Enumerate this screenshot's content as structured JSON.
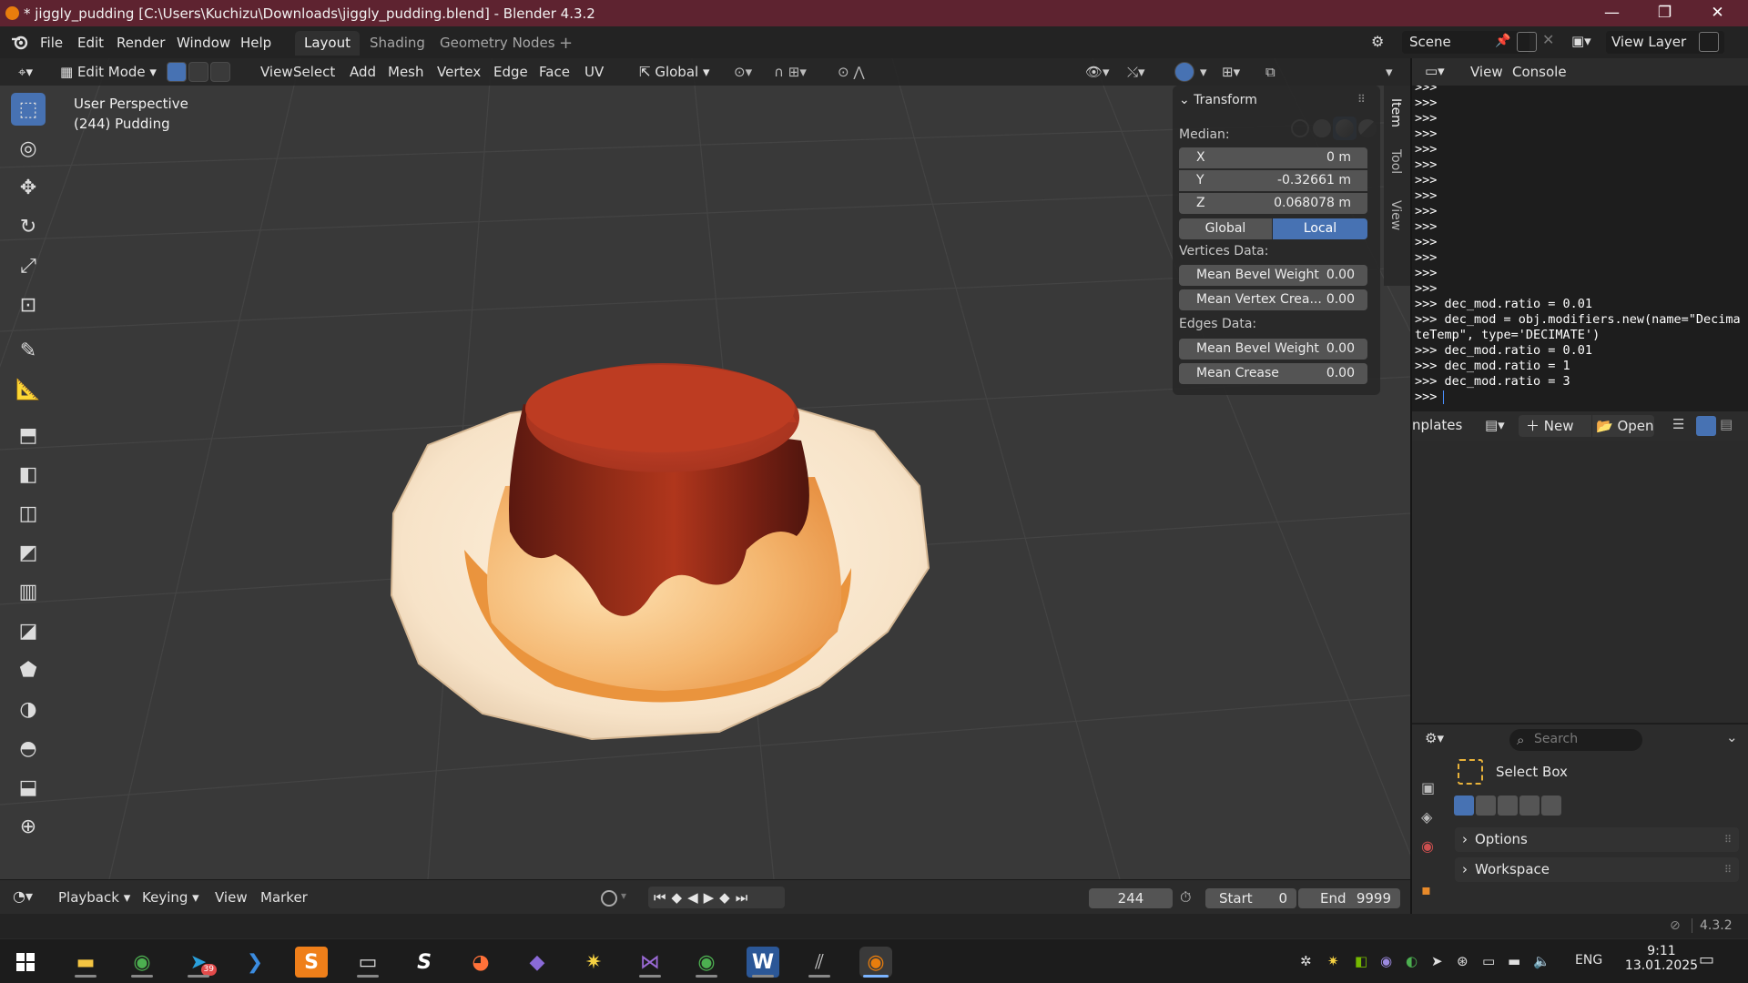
{
  "window": {
    "title": "* jiggly_pudding [C:\\Users\\Kuchizu\\Downloads\\jiggly_pudding.blend] - Blender 4.3.2",
    "controls": [
      "—",
      "❐",
      "✕"
    ]
  },
  "topbar": {
    "menus": [
      "File",
      "Edit",
      "Render",
      "Window",
      "Help"
    ],
    "workspaces": [
      "Layout",
      "Shading",
      "Geometry Nodes"
    ],
    "active_workspace": "Layout",
    "add_workspace": "+",
    "scene_label": "Scene",
    "view_layer_label": "View Layer"
  },
  "viewport_header": {
    "mode": "Edit Mode",
    "menus": [
      "View",
      "Select",
      "Add",
      "Mesh",
      "Vertex",
      "Edge",
      "Face",
      "UV"
    ],
    "transform_orientation": "Global"
  },
  "viewport": {
    "info_line1": "User Perspective",
    "info_line2": "(244) Pudding",
    "colors": {
      "background": "#393939",
      "grid": "#444444"
    }
  },
  "npanel": {
    "section": "Transform",
    "median_label": "Median:",
    "fields": [
      {
        "key": "X",
        "value": "0 m"
      },
      {
        "key": "Y",
        "value": "-0.32661 m"
      },
      {
        "key": "Z",
        "value": "0.068078 m"
      }
    ],
    "toggle": [
      "Global",
      "Local"
    ],
    "toggle_active": "Local",
    "vertices_label": "Vertices Data:",
    "vertices_fields": [
      {
        "key": "Mean Bevel Weight",
        "value": "0.00"
      },
      {
        "key": "Mean Vertex Crea...",
        "value": "0.00"
      }
    ],
    "edges_label": "Edges Data:",
    "edges_fields": [
      {
        "key": "Mean Bevel Weight",
        "value": "0.00"
      },
      {
        "key": "Mean Crease",
        "value": "0.00"
      }
    ],
    "tabs": [
      "Item",
      "Tool",
      "View"
    ]
  },
  "timeline": {
    "menus": [
      "Playback",
      "Keying",
      "View",
      "Marker"
    ],
    "current_frame": "244",
    "start_label": "Start",
    "start_value": "0",
    "end_label": "End",
    "end_value": "9999"
  },
  "console": {
    "menus": [
      "View",
      "Console"
    ],
    "lines": [
      ">>>",
      ">>>",
      ">>>",
      ">>>",
      ">>>",
      ">>>",
      ">>>",
      ">>>",
      ">>>",
      ">>>",
      ">>>",
      ">>>",
      ">>>",
      ">>>",
      ">>> dec_mod.ratio = 0.01",
      ">>> dec_mod = obj.modifiers.new(name=\"Decima",
      "teTemp\", type='DECIMATE')",
      ">>> dec_mod.ratio = 0.01",
      ">>> dec_mod.ratio = 1",
      ">>> dec_mod.ratio = 3",
      ">>> "
    ]
  },
  "templates": {
    "label": "nplates",
    "new_label": "New",
    "open_label": "Open"
  },
  "properties": {
    "search_placeholder": "Search",
    "tool_name": "Select Box",
    "sections": [
      "Options",
      "Workspace"
    ]
  },
  "statusbar": {
    "version": "4.3.2"
  },
  "taskbar": {
    "telegram_badge": "39",
    "language": "ENG",
    "time": "9:11",
    "date": "13.01.2025"
  }
}
